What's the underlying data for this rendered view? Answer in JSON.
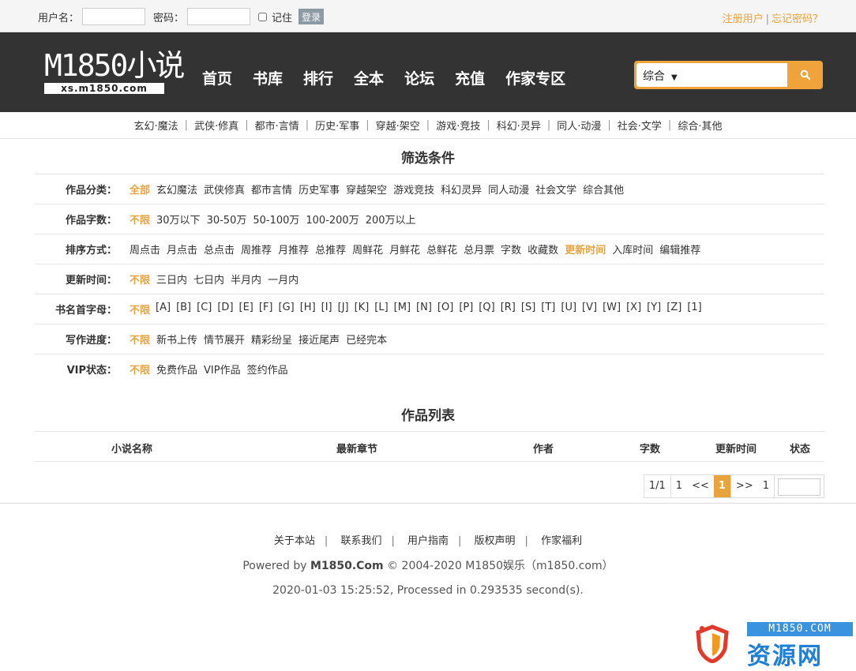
{
  "login": {
    "username_label": "用户名：",
    "password_label": "密码：",
    "remember_label": "记住",
    "login_button": "登录",
    "register_link": "注册用户",
    "forgot_link": "忘记密码？",
    "separator": "|"
  },
  "logo": {
    "main": "M1850小说",
    "sub": "xs.m1850.com"
  },
  "nav": [
    "首页",
    "书库",
    "排行",
    "全本",
    "论坛",
    "充值",
    "作家专区"
  ],
  "search": {
    "scope": "综合",
    "icon": "search-icon"
  },
  "categories": [
    "玄幻·魔法",
    "武侠·修真",
    "都市·言情",
    "历史·军事",
    "穿越·架空",
    "游戏·竞技",
    "科幻·灵异",
    "同人·动漫",
    "社会·文学",
    "综合·其他"
  ],
  "filter_title": "筛选条件",
  "filters": {
    "genre": {
      "label": "作品分类：",
      "options": [
        "全部",
        "玄幻魔法",
        "武侠修真",
        "都市言情",
        "历史军事",
        "穿越架空",
        "游戏竞技",
        "科幻灵异",
        "同人动漫",
        "社会文学",
        "综合其他"
      ]
    },
    "words": {
      "label": "作品字数：",
      "options": [
        "不限",
        "30万以下",
        "30-50万",
        "50-100万",
        "100-200万",
        "200万以上"
      ]
    },
    "sort": {
      "label": "排序方式：",
      "options": [
        "周点击",
        "月点击",
        "总点击",
        "周推荐",
        "月推荐",
        "总推荐",
        "周鲜花",
        "月鲜花",
        "总鲜花",
        "总月票",
        "字数",
        "收藏数",
        "更新时间",
        "入库时间",
        "编辑推荐"
      ]
    },
    "updated": {
      "label": "更新时间：",
      "options": [
        "不限",
        "三日内",
        "七日内",
        "半月内",
        "一月内"
      ]
    },
    "initial": {
      "label": "书名首字母：",
      "options": [
        "不限",
        "[A]",
        "[B]",
        "[C]",
        "[D]",
        "[E]",
        "[F]",
        "[G]",
        "[H]",
        "[I]",
        "[J]",
        "[K]",
        "[L]",
        "[M]",
        "[N]",
        "[O]",
        "[P]",
        "[Q]",
        "[R]",
        "[S]",
        "[T]",
        "[U]",
        "[V]",
        "[W]",
        "[X]",
        "[Y]",
        "[Z]",
        "[1]"
      ]
    },
    "progress": {
      "label": "写作进度：",
      "options": [
        "不限",
        "新书上传",
        "情节展开",
        "精彩纷呈",
        "接近尾声",
        "已经完本"
      ]
    },
    "vip": {
      "label": "VIP状态：",
      "options": [
        "不限",
        "免费作品",
        "VIP作品",
        "签约作品"
      ]
    }
  },
  "list_title": "作品列表",
  "columns": [
    "小说名称",
    "最新章节",
    "作者",
    "字数",
    "更新时间",
    "状态"
  ],
  "pager": {
    "info": "1/1",
    "first": "1",
    "prev": "<<",
    "current": "1",
    "next": ">>",
    "last": "1"
  },
  "footer": {
    "links": [
      "关于本站",
      "联系我们",
      "用户指南",
      "版权声明",
      "作家福利"
    ],
    "powered_prefix": "Powered by ",
    "powered_brand": "M1850.Com",
    "powered_suffix": " © 2004-2020 M1850娱乐（m1850.com）",
    "processed": "2020-01-03 15:25:52, Processed in 0.293535 second(s)."
  },
  "watermark": {
    "domain": "M1850.COM",
    "name": "资源网"
  }
}
